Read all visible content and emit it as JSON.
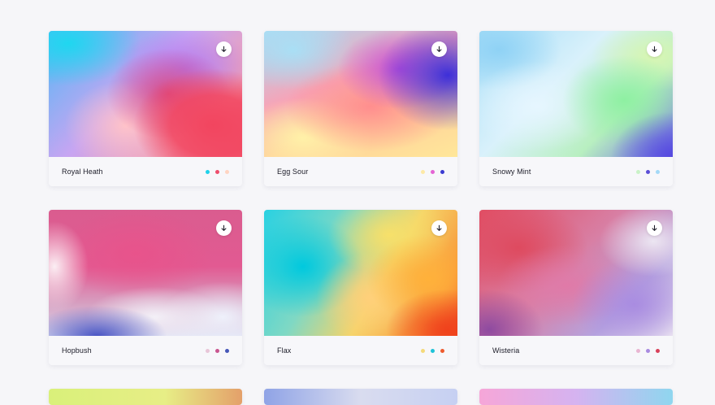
{
  "cards": [
    {
      "name": "Royal Heath",
      "colors": [
        "#1fd1ea",
        "#ee4d6c",
        "#ffd4c2"
      ]
    },
    {
      "name": "Egg Sour",
      "colors": [
        "#fde9a6",
        "#e464d4",
        "#3b3bd1"
      ]
    },
    {
      "name": "Snowy Mint",
      "colors": [
        "#c9f2c7",
        "#5b4ed6",
        "#a3d9f7"
      ]
    },
    {
      "name": "Hopbush",
      "colors": [
        "#e8c6d8",
        "#c9558f",
        "#4656b8"
      ]
    },
    {
      "name": "Flax",
      "colors": [
        "#f4d97a",
        "#1ec3d8",
        "#ee5a2d"
      ]
    },
    {
      "name": "Wisteria",
      "colors": [
        "#e9b6d2",
        "#a98ae0",
        "#d8405a"
      ]
    }
  ],
  "icons": {
    "download": "download-arrow-icon"
  }
}
